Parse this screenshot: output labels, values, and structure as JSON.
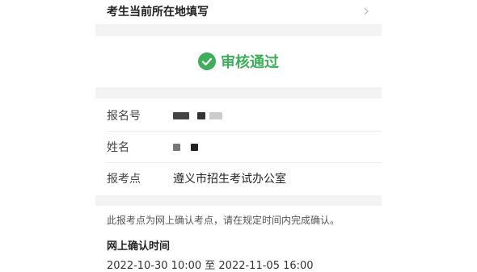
{
  "location_row": {
    "label": "考生当前所在地填写",
    "chevron_icon": "chevron-right-icon"
  },
  "status": {
    "icon": "check-circle-icon",
    "text": "审核通过",
    "color": "#3fae5a"
  },
  "info": {
    "registration_no_label": "报名号",
    "name_label": "姓名",
    "exam_site_label": "报考点",
    "exam_site_value": "遵义市招生考试办公室"
  },
  "note": "此报考点为网上确认考点，请在规定时间内完成确认。",
  "online_confirm": {
    "title": "网上确认时间",
    "time": "2022-10-30 10:00 至 2022-11-05 16:00"
  }
}
